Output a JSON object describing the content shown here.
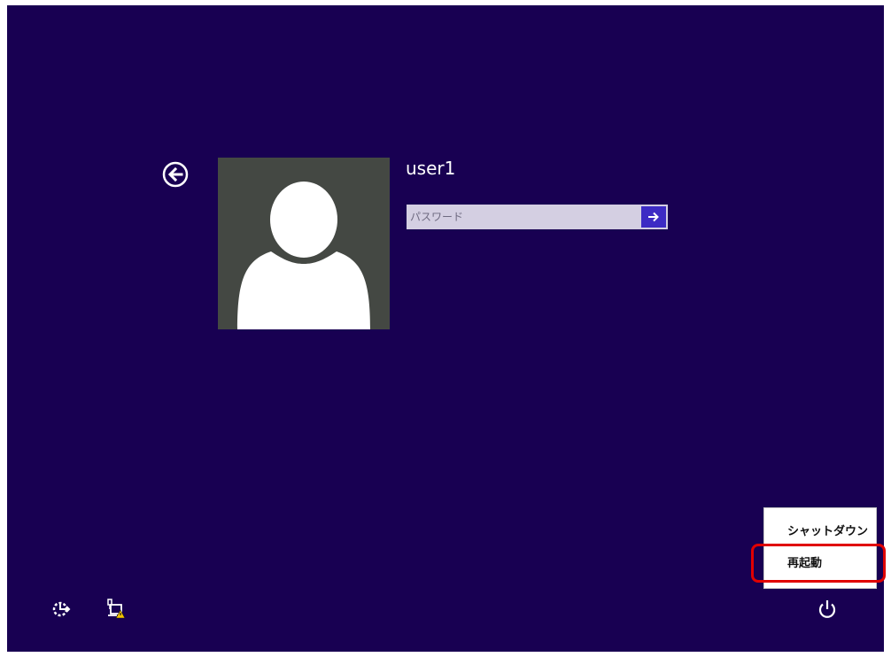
{
  "login": {
    "username": "user1",
    "password_placeholder": "パスワード"
  },
  "power_menu": {
    "items": [
      {
        "label": "シャットダウン"
      },
      {
        "label": "再起動"
      }
    ],
    "highlighted_item": "再起動"
  },
  "icons": {
    "back": "back-arrow-circle-icon",
    "submit": "arrow-right-icon",
    "avatar": "default-user-avatar",
    "ease_of_access": "ease-of-access-icon",
    "network": "network-warning-icon",
    "power": "power-icon"
  },
  "colors": {
    "background": "#180052",
    "avatar_background": "#444843",
    "password_field": "#d4cfe2",
    "submit_button": "#3d2bc4",
    "highlight": "#e00000"
  }
}
